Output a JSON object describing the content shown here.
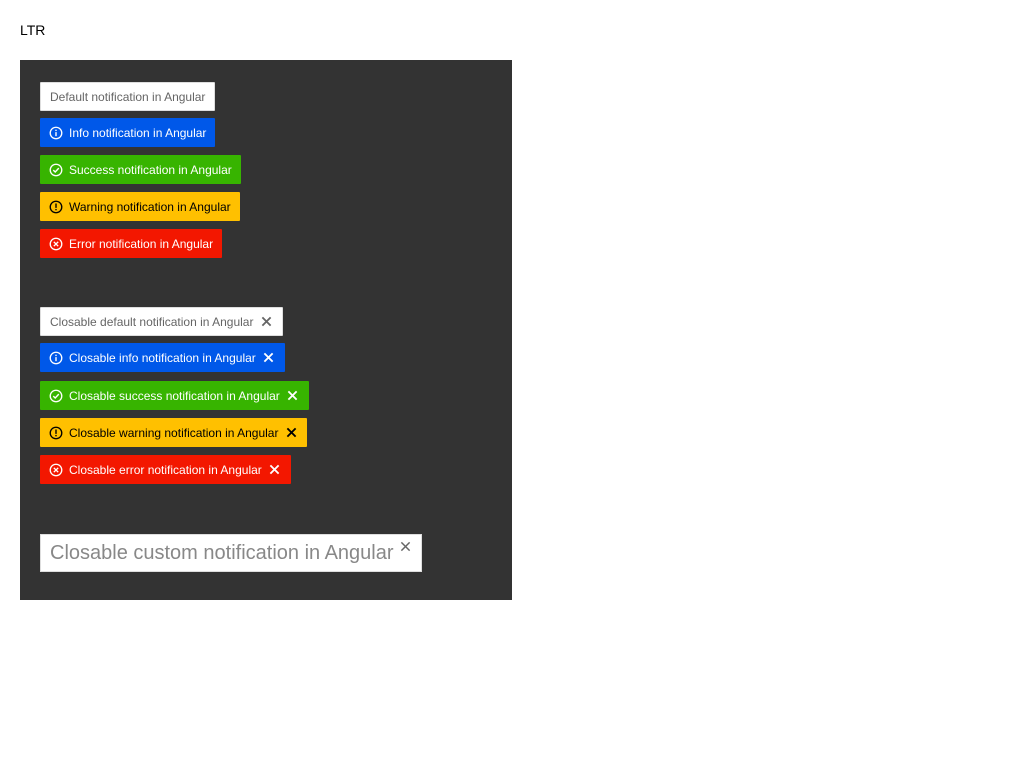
{
  "direction_label": "LTR",
  "colors": {
    "panel_bg": "#333333",
    "default": "#ffffff",
    "info": "#0058e9",
    "success": "#37b400",
    "warning": "#ffc000",
    "error": "#f31700"
  },
  "notifications": [
    {
      "type": "default",
      "text": "Default notification in Angular",
      "icon": null
    },
    {
      "type": "info",
      "text": "Info notification in Angular",
      "icon": "info-circle-icon"
    },
    {
      "type": "success",
      "text": "Success notification in Angular",
      "icon": "check-circle-icon"
    },
    {
      "type": "warning",
      "text": "Warning notification in Angular",
      "icon": "exclamation-circle-icon"
    },
    {
      "type": "error",
      "text": "Error notification in Angular",
      "icon": "x-circle-icon"
    }
  ],
  "closable_notifications": [
    {
      "type": "default",
      "text": "Closable default notification in Angular",
      "icon": null,
      "close_icon": "close-icon"
    },
    {
      "type": "info",
      "text": "Closable info notification in Angular",
      "icon": "info-circle-icon",
      "close_icon": "close-icon"
    },
    {
      "type": "success",
      "text": "Closable success notification in Angular",
      "icon": "check-circle-icon",
      "close_icon": "close-icon"
    },
    {
      "type": "warning",
      "text": "Closable warning notification in Angular",
      "icon": "exclamation-circle-icon",
      "close_icon": "close-icon"
    },
    {
      "type": "error",
      "text": "Closable error notification in Angular",
      "icon": "x-circle-icon",
      "close_icon": "close-icon"
    }
  ],
  "custom_notification": {
    "text": "Closable custom notification in Angular",
    "close_icon": "close-icon"
  }
}
